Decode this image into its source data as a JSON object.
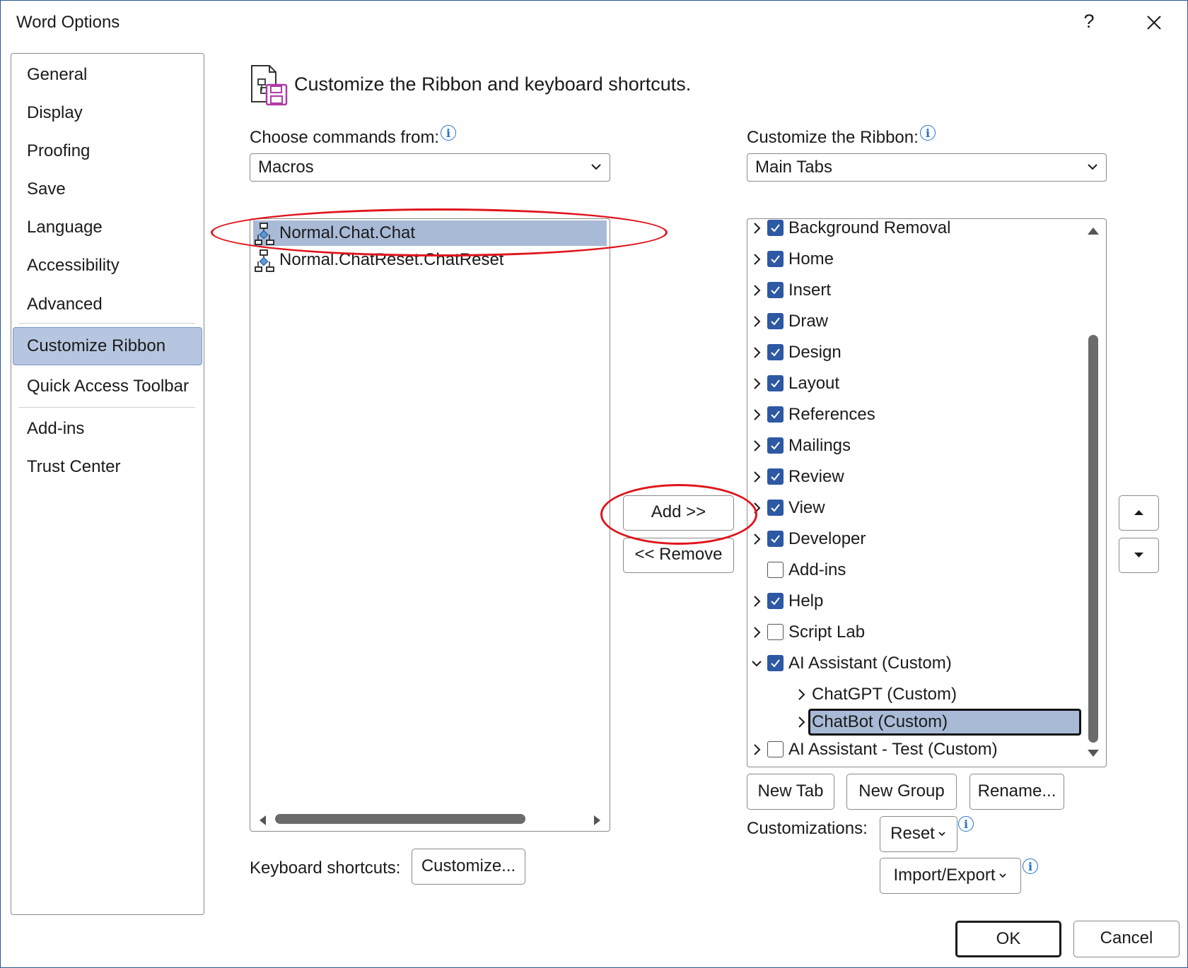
{
  "window": {
    "title": "Word Options",
    "help_label": "?"
  },
  "sidebar": {
    "items": [
      {
        "label": "General"
      },
      {
        "label": "Display"
      },
      {
        "label": "Proofing"
      },
      {
        "label": "Save"
      },
      {
        "label": "Language"
      },
      {
        "label": "Accessibility"
      },
      {
        "label": "Advanced"
      },
      {
        "label": "Customize Ribbon",
        "selected": true
      },
      {
        "label": "Quick Access Toolbar"
      },
      {
        "label": "Add-ins"
      },
      {
        "label": "Trust Center"
      }
    ]
  },
  "header": {
    "icon": "customize-ribbon-icon",
    "text": "Customize the Ribbon and keyboard shortcuts."
  },
  "commands": {
    "label": "Choose commands from:",
    "selected": "Macros",
    "items": [
      {
        "label": "Normal.Chat.Chat",
        "selected": true,
        "icon": "macro-icon"
      },
      {
        "label": "Normal.ChatReset.ChatReset",
        "selected": false,
        "icon": "macro-icon"
      }
    ]
  },
  "middle": {
    "add_label": "Add >>",
    "remove_label": "<< Remove"
  },
  "ribbon": {
    "label": "Customize the Ribbon:",
    "selected": "Main Tabs",
    "tabs": [
      {
        "label": "Background Removal",
        "checked": true,
        "expander": "collapsed",
        "level": 0
      },
      {
        "label": "Home",
        "checked": true,
        "expander": "collapsed",
        "level": 0
      },
      {
        "label": "Insert",
        "checked": true,
        "expander": "collapsed",
        "level": 0
      },
      {
        "label": "Draw",
        "checked": true,
        "expander": "collapsed",
        "level": 0
      },
      {
        "label": "Design",
        "checked": true,
        "expander": "collapsed",
        "level": 0
      },
      {
        "label": "Layout",
        "checked": true,
        "expander": "collapsed",
        "level": 0
      },
      {
        "label": "References",
        "checked": true,
        "expander": "collapsed",
        "level": 0
      },
      {
        "label": "Mailings",
        "checked": true,
        "expander": "collapsed",
        "level": 0
      },
      {
        "label": "Review",
        "checked": true,
        "expander": "collapsed",
        "level": 0
      },
      {
        "label": "View",
        "checked": true,
        "expander": "collapsed",
        "level": 0
      },
      {
        "label": "Developer",
        "checked": true,
        "expander": "collapsed",
        "level": 0
      },
      {
        "label": "Add-ins",
        "checked": false,
        "expander": "none",
        "level": 0
      },
      {
        "label": "Help",
        "checked": true,
        "expander": "collapsed",
        "level": 0
      },
      {
        "label": "Script Lab",
        "checked": false,
        "expander": "collapsed",
        "level": 0
      },
      {
        "label": "AI Assistant (Custom)",
        "checked": true,
        "expander": "expanded",
        "level": 0
      },
      {
        "label": "ChatGPT (Custom)",
        "checked": null,
        "expander": "collapsed",
        "level": 1
      },
      {
        "label": "ChatBot (Custom)",
        "checked": null,
        "expander": "collapsed",
        "level": 1,
        "selected": true
      },
      {
        "label": "AI Assistant - Test (Custom)",
        "checked": false,
        "expander": "collapsed",
        "level": 0
      }
    ],
    "new_tab_label": "New Tab",
    "new_group_label": "New Group",
    "rename_label": "Rename..."
  },
  "customizations": {
    "label": "Customizations:",
    "reset_label": "Reset",
    "import_export_label": "Import/Export"
  },
  "keyboard": {
    "label": "Keyboard shortcuts:",
    "customize_label": "Customize..."
  },
  "footer": {
    "ok_label": "OK",
    "cancel_label": "Cancel"
  },
  "colors": {
    "checkbox": "#2d58a3",
    "selection": "#a8bad6",
    "annotation": "#e0141c",
    "info": "#2472c8"
  }
}
